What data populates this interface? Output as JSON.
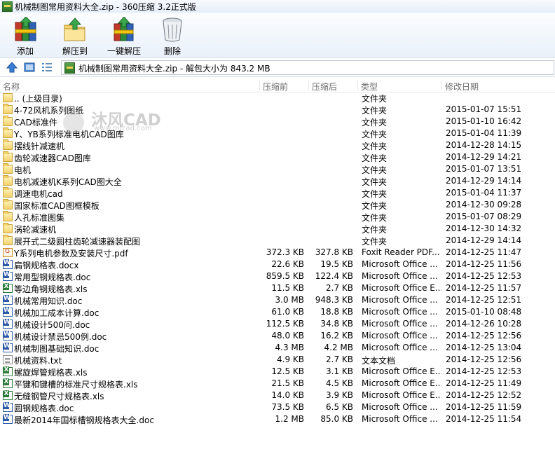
{
  "window": {
    "title": "机械制图常用资料大全.zip - 360压缩 3.2正式版"
  },
  "toolbar": {
    "add": "添加",
    "extract_to": "解压到",
    "one_click": "一键解压",
    "delete": "删除"
  },
  "nav": {
    "path": "机械制图常用资料大全.zip - 解包大小为 843.2 MB"
  },
  "columns": {
    "name": "名称",
    "compressed": "压缩前",
    "uncompressed": "压缩后",
    "type": "类型",
    "modified": "修改日期"
  },
  "watermark": {
    "text": "沐风CAD",
    "url": "www.mfcad.com"
  },
  "files": [
    {
      "name": ".. (上级目录)",
      "compressed": "",
      "uncompressed": "",
      "type": "文件夹",
      "date": "",
      "icon": "up-folder-icon"
    },
    {
      "name": "4-72风机系列图纸",
      "compressed": "",
      "uncompressed": "",
      "type": "文件夹",
      "date": "2015-01-07 15:51",
      "icon": "folder-icon"
    },
    {
      "name": "CAD标准件",
      "compressed": "",
      "uncompressed": "",
      "type": "文件夹",
      "date": "2015-01-10 16:42",
      "icon": "folder-icon"
    },
    {
      "name": "Y、YB系列标准电机CAD图库",
      "compressed": "",
      "uncompressed": "",
      "type": "文件夹",
      "date": "2015-01-04 11:39",
      "icon": "folder-icon"
    },
    {
      "name": "摆线针减速机",
      "compressed": "",
      "uncompressed": "",
      "type": "文件夹",
      "date": "2014-12-28 14:15",
      "icon": "folder-icon"
    },
    {
      "name": "齿轮减速器CAD图库",
      "compressed": "",
      "uncompressed": "",
      "type": "文件夹",
      "date": "2014-12-29 14:21",
      "icon": "folder-icon"
    },
    {
      "name": "电机",
      "compressed": "",
      "uncompressed": "",
      "type": "文件夹",
      "date": "2015-01-07 13:51",
      "icon": "folder-icon"
    },
    {
      "name": "电机减速机K系列CAD图大全",
      "compressed": "",
      "uncompressed": "",
      "type": "文件夹",
      "date": "2014-12-29 14:14",
      "icon": "folder-icon"
    },
    {
      "name": "调速电机cad",
      "compressed": "",
      "uncompressed": "",
      "type": "文件夹",
      "date": "2015-01-04 11:37",
      "icon": "folder-icon"
    },
    {
      "name": "国家标准CAD图框模板",
      "compressed": "",
      "uncompressed": "",
      "type": "文件夹",
      "date": "2014-12-30 09:28",
      "icon": "folder-icon"
    },
    {
      "name": "人孔标准图集",
      "compressed": "",
      "uncompressed": "",
      "type": "文件夹",
      "date": "2015-01-07 08:29",
      "icon": "folder-icon"
    },
    {
      "name": "涡轮减速机",
      "compressed": "",
      "uncompressed": "",
      "type": "文件夹",
      "date": "2014-12-30 14:32",
      "icon": "folder-icon"
    },
    {
      "name": "展开式二级圆柱齿轮减速器装配图",
      "compressed": "",
      "uncompressed": "",
      "type": "文件夹",
      "date": "2014-12-29 14:14",
      "icon": "folder-icon"
    },
    {
      "name": "Y系列电机参数及安装尺寸.pdf",
      "compressed": "372.3 KB",
      "uncompressed": "327.8 KB",
      "type": "Foxit Reader PDF...",
      "date": "2014-12-25 11:47",
      "icon": "pdf-icon"
    },
    {
      "name": "扁钢规格表.docx",
      "compressed": "22.6 KB",
      "uncompressed": "19.5 KB",
      "type": "Microsoft Office ...",
      "date": "2014-12-25 11:56",
      "icon": "doc-icon"
    },
    {
      "name": "常用型钢规格表.doc",
      "compressed": "859.5 KB",
      "uncompressed": "122.4 KB",
      "type": "Microsoft Office ...",
      "date": "2014-12-25 12:53",
      "icon": "doc-icon"
    },
    {
      "name": "等边角钢规格表.xls",
      "compressed": "11.5 KB",
      "uncompressed": "2.7 KB",
      "type": "Microsoft Office E...",
      "date": "2014-12-25 11:57",
      "icon": "xls-icon"
    },
    {
      "name": "机械常用知识.doc",
      "compressed": "3.0 MB",
      "uncompressed": "948.3 KB",
      "type": "Microsoft Office ...",
      "date": "2014-12-25 12:51",
      "icon": "doc-icon"
    },
    {
      "name": "机械加工成本计算.doc",
      "compressed": "61.0 KB",
      "uncompressed": "18.8 KB",
      "type": "Microsoft Office ...",
      "date": "2015-01-10 08:48",
      "icon": "doc-icon"
    },
    {
      "name": "机械设计500问.doc",
      "compressed": "112.5 KB",
      "uncompressed": "34.8 KB",
      "type": "Microsoft Office ...",
      "date": "2014-12-26 10:28",
      "icon": "doc-icon"
    },
    {
      "name": "机械设计禁忌500例.doc",
      "compressed": "48.0 KB",
      "uncompressed": "16.2 KB",
      "type": "Microsoft Office ...",
      "date": "2014-12-25 12:56",
      "icon": "doc-icon"
    },
    {
      "name": "机械制图基础知识.doc",
      "compressed": "4.3 MB",
      "uncompressed": "4.2 MB",
      "type": "Microsoft Office ...",
      "date": "2014-12-25 13:04",
      "icon": "doc-icon"
    },
    {
      "name": "机械资料.txt",
      "compressed": "4.9 KB",
      "uncompressed": "2.7 KB",
      "type": "文本文档",
      "date": "2014-12-25 12:56",
      "icon": "txt-icon"
    },
    {
      "name": "螺旋焊管规格表.xls",
      "compressed": "12.5 KB",
      "uncompressed": "3.1 KB",
      "type": "Microsoft Office E...",
      "date": "2014-12-25 12:53",
      "icon": "xls-icon"
    },
    {
      "name": "平键和键槽的标准尺寸规格表.xls",
      "compressed": "21.5 KB",
      "uncompressed": "4.5 KB",
      "type": "Microsoft Office E...",
      "date": "2014-12-25 11:49",
      "icon": "xls-icon"
    },
    {
      "name": "无缝钢管尺寸规格表.xls",
      "compressed": "14.0 KB",
      "uncompressed": "3.9 KB",
      "type": "Microsoft Office E...",
      "date": "2014-12-25 12:52",
      "icon": "xls-icon"
    },
    {
      "name": "圆钢规格表.doc",
      "compressed": "73.5 KB",
      "uncompressed": "6.5 KB",
      "type": "Microsoft Office ...",
      "date": "2014-12-25 11:59",
      "icon": "doc-icon"
    },
    {
      "name": "最新2014年国标槽钢规格表大全.doc",
      "compressed": "1.2 MB",
      "uncompressed": "85.0 KB",
      "type": "Microsoft Office ...",
      "date": "2014-12-25 11:54",
      "icon": "doc-icon"
    }
  ]
}
